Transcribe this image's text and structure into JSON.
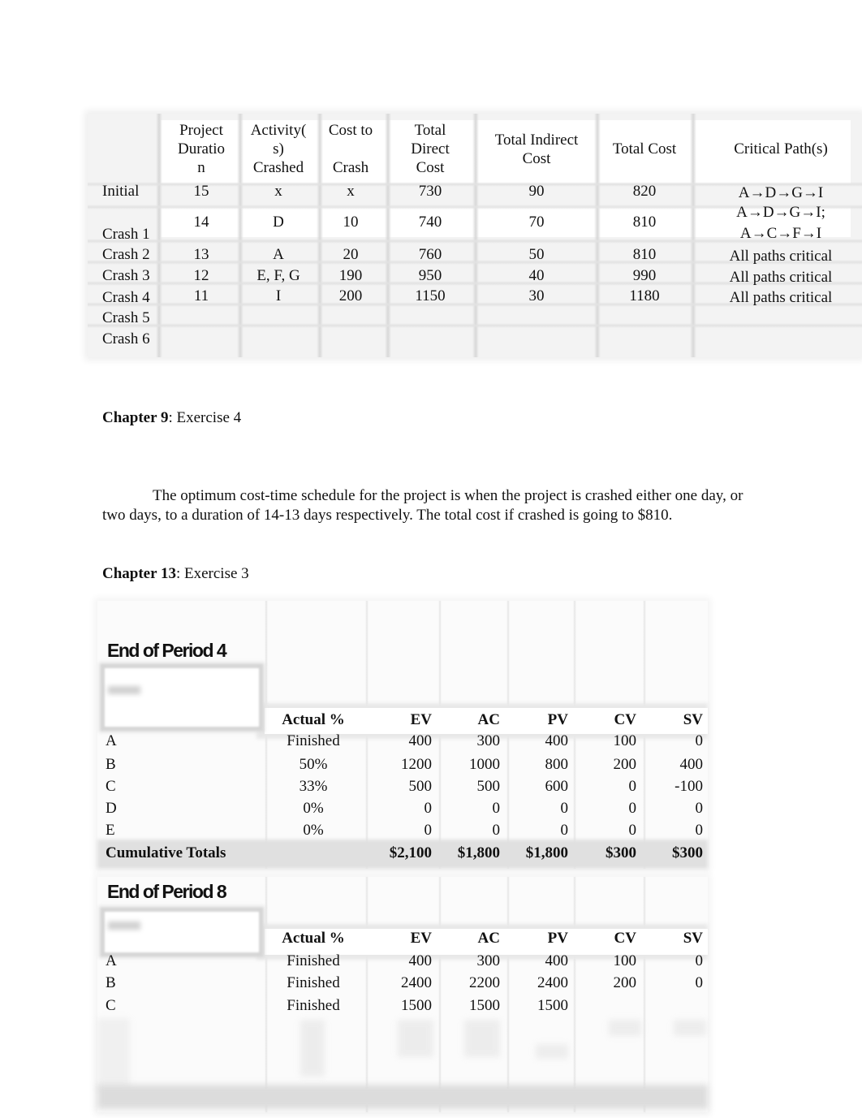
{
  "crash_table": {
    "headers": {
      "duration": [
        "Project",
        "Duratio",
        "n"
      ],
      "activities": [
        "Activity(",
        "s)",
        "Crashed"
      ],
      "cost_to_crash": [
        "Cost to",
        "",
        "Crash"
      ],
      "total_direct": [
        "Total",
        "Direct",
        "Cost"
      ],
      "total_indirect": [
        "Total Indirect",
        "Cost"
      ],
      "total_cost": "Total Cost",
      "critical_paths": "Critical Path(s)"
    },
    "rows": [
      {
        "label": "Initial",
        "duration": "15",
        "activities": "x",
        "cost_to_crash": "x",
        "total_direct": "730",
        "total_indirect": "90",
        "total_cost": "820",
        "critical": [
          "A→D→G→I"
        ]
      },
      {
        "label": "Crash 1",
        "duration": "14",
        "activities": "D",
        "cost_to_crash": "10",
        "total_direct": "740",
        "total_indirect": "70",
        "total_cost": "810",
        "critical": [
          "A→D→G→I;",
          "A→C→F→I"
        ]
      },
      {
        "label": "Crash 2",
        "duration": "13",
        "activities": "A",
        "cost_to_crash": "20",
        "total_direct": "760",
        "total_indirect": "50",
        "total_cost": "810",
        "critical": [
          "All paths critical"
        ]
      },
      {
        "label": "Crash 3",
        "duration": "12",
        "activities": "E, F, G",
        "cost_to_crash": "190",
        "total_direct": "950",
        "total_indirect": "40",
        "total_cost": "990",
        "critical": [
          "All paths critical"
        ]
      },
      {
        "label": "Crash 4",
        "duration": "11",
        "activities": "I",
        "cost_to_crash": "200",
        "total_direct": "1150",
        "total_indirect": "30",
        "total_cost": "1180",
        "critical": [
          "All paths critical"
        ]
      },
      {
        "label": "Crash 5",
        "duration": "",
        "activities": "",
        "cost_to_crash": "",
        "total_direct": "",
        "total_indirect": "",
        "total_cost": "",
        "critical": [
          ""
        ]
      },
      {
        "label": "Crash 6",
        "duration": "",
        "activities": "",
        "cost_to_crash": "",
        "total_direct": "",
        "total_indirect": "",
        "total_cost": "",
        "critical": [
          ""
        ]
      }
    ]
  },
  "chapter9": {
    "bold": "Chapter 9",
    "rest": ": Exercise 4",
    "paragraph": "The optimum cost-time schedule for the project is when the project is crashed either one day, or two days, to a duration of 14-13 days respectively. The total cost if crashed is going to $810."
  },
  "chapter13": {
    "bold": "Chapter 13",
    "rest": ": Exercise 3"
  },
  "ev_tables": [
    {
      "title": "End of Period 4",
      "columns": [
        "Actual %",
        "EV",
        "AC",
        "PV",
        "CV",
        "SV"
      ],
      "rows": [
        {
          "task": "A",
          "actual": "Finished",
          "ev": "400",
          "ac": "300",
          "pv": "400",
          "cv": "100",
          "sv": "0"
        },
        {
          "task": "B",
          "actual": "50%",
          "ev": "1200",
          "ac": "1000",
          "pv": "800",
          "cv": "200",
          "sv": "400"
        },
        {
          "task": "C",
          "actual": "33%",
          "ev": "500",
          "ac": "500",
          "pv": "600",
          "cv": "0",
          "sv": "-100"
        },
        {
          "task": "D",
          "actual": "0%",
          "ev": "0",
          "ac": "0",
          "pv": "0",
          "cv": "0",
          "sv": "0"
        },
        {
          "task": "E",
          "actual": "0%",
          "ev": "0",
          "ac": "0",
          "pv": "0",
          "cv": "0",
          "sv": "0"
        }
      ],
      "totals": {
        "label": "Cumulative Totals",
        "ev": "$2,100",
        "ac": "$1,800",
        "pv": "$1,800",
        "cv": "$300",
        "sv": "$300"
      }
    },
    {
      "title": "End of Period 8",
      "columns": [
        "Actual %",
        "EV",
        "AC",
        "PV",
        "CV",
        "SV"
      ],
      "rows": [
        {
          "task": "A",
          "actual": "Finished",
          "ev": "400",
          "ac": "300",
          "pv": "400",
          "cv": "100",
          "sv": "0"
        },
        {
          "task": "B",
          "actual": "Finished",
          "ev": "2400",
          "ac": "2200",
          "pv": "2400",
          "cv": "200",
          "sv": "0"
        },
        {
          "task": "C",
          "actual": "Finished",
          "ev": "1500",
          "ac": "1500",
          "pv": "1500",
          "cv": "",
          "sv": ""
        }
      ]
    }
  ]
}
